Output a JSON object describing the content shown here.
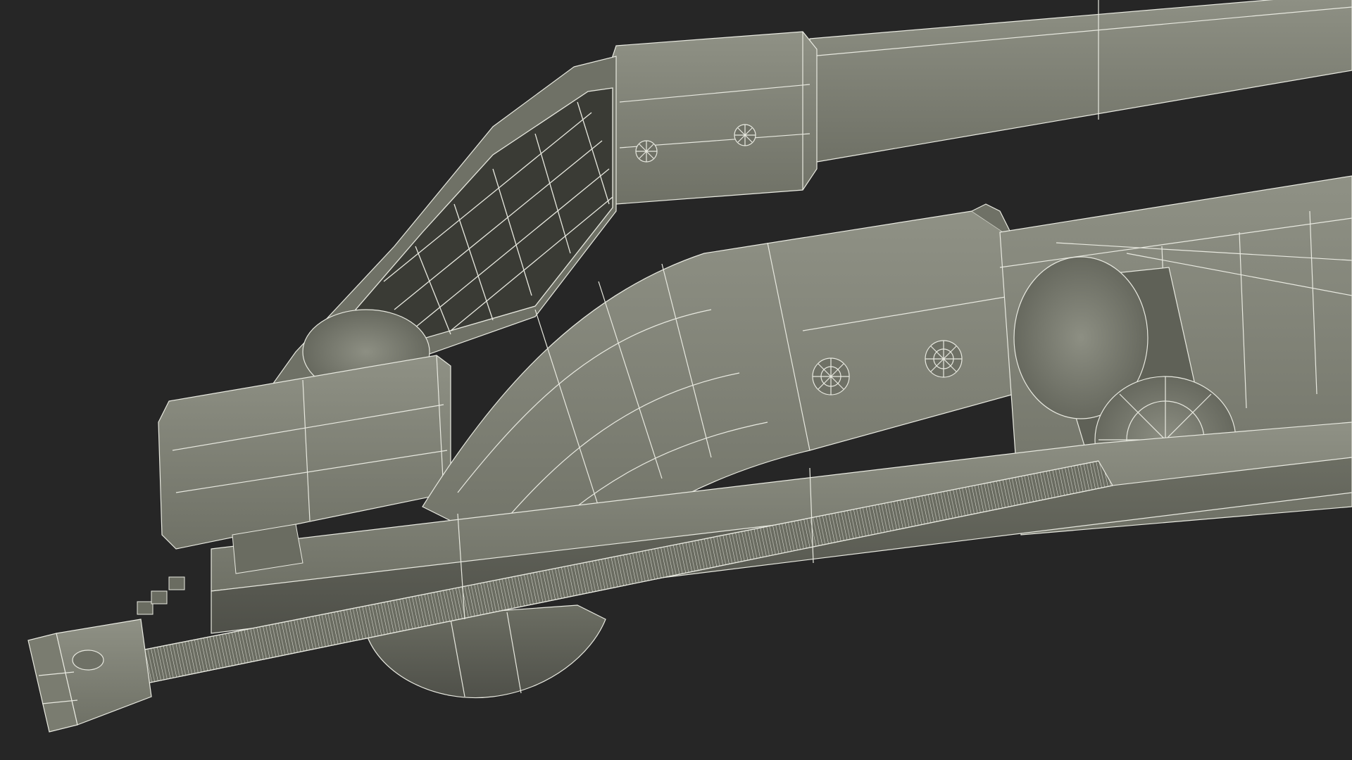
{
  "scene": {
    "subject": "wireframe-3d-model-render",
    "colors": {
      "background": "#262626",
      "surface_light": "#8a8c80",
      "surface_mid": "#75776b",
      "surface_dark": "#5c5e54",
      "surface_shadow": "#45463f",
      "wire": "#e8e9e0",
      "grille_dark": "#3a3b35"
    },
    "icons": {
      "bolt": "bolt-icon",
      "roller": "roller-icon",
      "rack": "rack-icon"
    }
  }
}
